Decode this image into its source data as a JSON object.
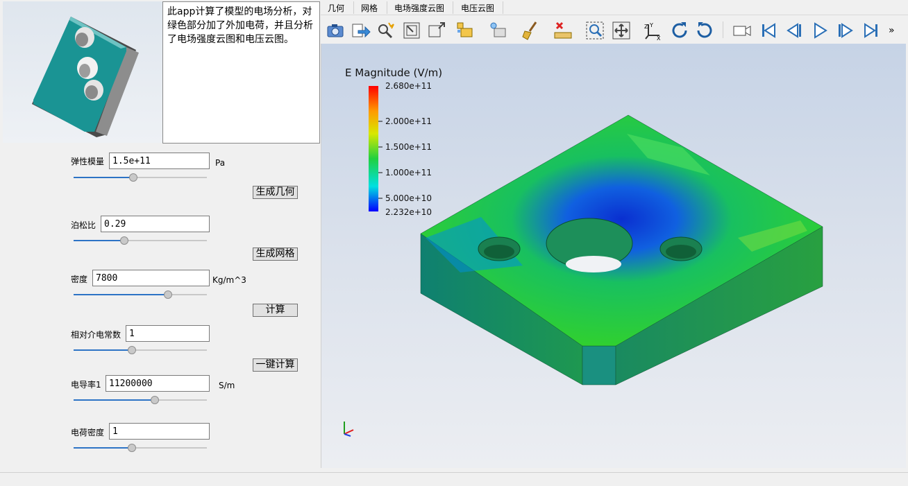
{
  "description": "此app计算了模型的电场分析，对绿色部分加了外加电荷，并且分析了电场强度云图和电压云图。",
  "params": [
    {
      "label": "弹性模量",
      "value": "1.5e+11",
      "unit": "Pa",
      "slider": 0.45
    },
    {
      "label": "泊松比",
      "value": "0.29",
      "unit": "",
      "slider": 0.38
    },
    {
      "label": "密度",
      "value": "7800",
      "unit": "Kg/m^3",
      "slider": 0.71
    },
    {
      "label": "相对介电常数",
      "value": "1",
      "unit": "",
      "slider": 0.44
    },
    {
      "label": "电导率1",
      "value": "11200000",
      "unit": "S/m",
      "slider": 0.61
    },
    {
      "label": "电荷密度",
      "value": "1",
      "unit": "",
      "slider": 0.44
    }
  ],
  "buttons": {
    "gen_geometry": "生成几何",
    "gen_mesh": "生成网格",
    "compute": "计算",
    "one_click": "一键计算"
  },
  "menus": [
    "几何",
    "网格",
    "电场强度云图",
    "电压云图"
  ],
  "toolbar_icons": [
    "camera-icon",
    "export-icon",
    "interact-select-icon",
    "reset-camera-icon",
    "zoom-box-icon",
    "select-cells-icon",
    "select-points-icon",
    "clear-selection-icon",
    "ruler-icon",
    "zoom-to-box-icon",
    "zoom-data-icon",
    "axes-icon",
    "rotate-cw-icon",
    "rotate-ccw-icon",
    "record-camera-icon",
    "first-frame-icon",
    "prev-frame-icon",
    "play-icon",
    "next-frame-icon",
    "last-frame-icon",
    "more-icon"
  ],
  "legend": {
    "title": "E Magnitude (V/m)",
    "ticks": [
      "2.680e+11",
      "2.000e+11",
      "1.500e+11",
      "1.000e+11",
      "5.000e+10",
      "2.232e+10"
    ],
    "colors": [
      "#ff0000",
      "#ffa000",
      "#e8e800",
      "#30d030",
      "#00e0e0",
      "#0000ff"
    ]
  }
}
